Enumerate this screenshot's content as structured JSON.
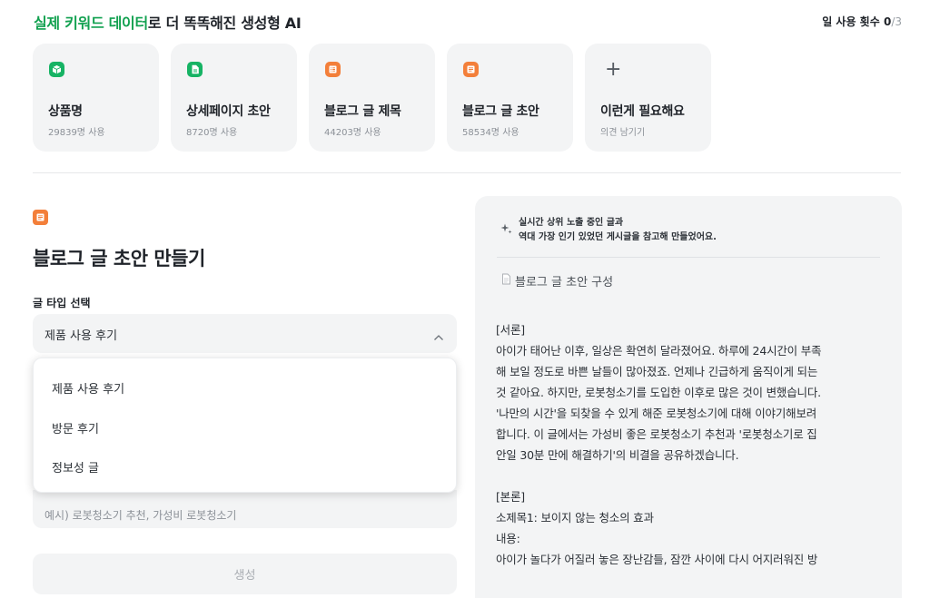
{
  "header": {
    "title_accent": "실제 키워드 데이터",
    "title_rest": "로 더 똑똑해진 생성형 AI",
    "usage_label": "일 사용 횟수",
    "usage_count": "0",
    "usage_max": "/3"
  },
  "cards": [
    {
      "title": "상품명",
      "sub": "29839명 사용",
      "icon": "box-icon",
      "color": "#16b364"
    },
    {
      "title": "상세페이지 초안",
      "sub": "8720명 사용",
      "icon": "document-icon",
      "color": "#16b364"
    },
    {
      "title": "블로그 글 제목",
      "sub": "44203명 사용",
      "icon": "list-icon",
      "color": "#f37f3a"
    },
    {
      "title": "블로그 글 초안",
      "sub": "58534명 사용",
      "icon": "text-icon",
      "color": "#f37f3a"
    },
    {
      "title": "이런게 필요해요",
      "sub": "의견 남기기",
      "icon": "plus-icon"
    }
  ],
  "form": {
    "title": "블로그 글 초안 만들기",
    "type_label": "글 타입 선택",
    "selected": "제품 사용 후기",
    "options": [
      "제품 사용 후기",
      "방문 후기",
      "정보성 글"
    ],
    "keyword_placeholder": "예시) 로봇청소기 추천, 가성비 로봇청소기",
    "generate_label": "생성"
  },
  "preview": {
    "heading1": "실시간 상위 노출 중인 글과",
    "heading2": "역대 가장 인기 있었던 게시글을 참고해 만들었어요.",
    "doc_title": "블로그 글 초안 구성",
    "intro_label": "[서론]",
    "intro_lines": [
      "아이가 태어난 이후, 일상은 확연히 달라졌어요. 하루에 24시간이 부족",
      "해 보일 정도로 바쁜 날들이 많아졌죠. 언제나 긴급하게 움직이게 되는",
      "것 같아요. 하지만, 로봇청소기를 도입한 이후로 많은 것이 변했습니다.",
      "'나만의 시간'을 되찾을 수 있게 해준 로봇청소기에 대해 이야기해보려",
      "합니다. 이 글에서는 가성비 좋은 로봇청소기 추천과 '로봇청소기로 집",
      "안일 30분 만에 해결하기'의 비결을 공유하겠습니다."
    ],
    "body_label": "[본론]",
    "subtitle1": "소제목1: 보이지 않는 청소의 효과",
    "content_label": "내용:",
    "content_line": "아이가 놀다가 어질러 놓은 장난감들, 잠깐 사이에 다시 어지러워진 방"
  },
  "colors": {
    "green": "#16b364",
    "orange": "#f37f3a",
    "card_bg": "#f3f4f5"
  }
}
